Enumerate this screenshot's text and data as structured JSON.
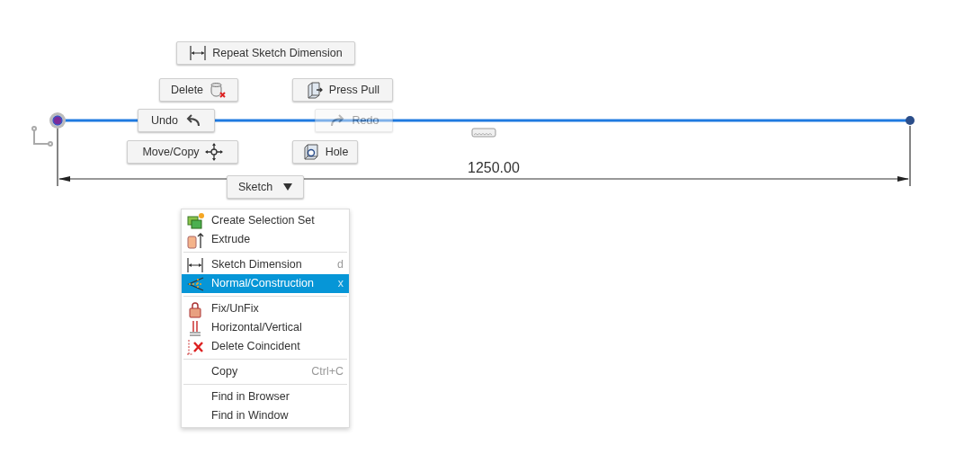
{
  "marking_menu": {
    "buttons": [
      {
        "label": "Repeat Sketch Dimension",
        "disabled": false
      },
      {
        "label": "Delete",
        "disabled": false
      },
      {
        "label": "Press Pull",
        "disabled": false
      },
      {
        "label": "Undo",
        "disabled": false
      },
      {
        "label": "Redo",
        "disabled": true
      },
      {
        "label": "Move/Copy",
        "disabled": false
      },
      {
        "label": "Hole",
        "disabled": false
      }
    ],
    "dropdown": {
      "label": "Sketch"
    }
  },
  "sketch": {
    "dimension": "1250.00"
  },
  "context_menu": {
    "groups": [
      {
        "items": [
          {
            "label": "Create Selection Set",
            "selected": false
          },
          {
            "label": "Extrude",
            "selected": false
          }
        ]
      },
      {
        "items": [
          {
            "label": "Sketch Dimension",
            "shortcut": "d",
            "selected": false
          },
          {
            "label": "Normal/Construction",
            "shortcut": "x",
            "selected": true
          }
        ]
      },
      {
        "items": [
          {
            "label": "Fix/UnFix",
            "selected": false
          },
          {
            "label": "Horizontal/Vertical",
            "selected": false
          },
          {
            "label": "Delete Coincident",
            "selected": false
          }
        ]
      },
      {
        "items": [
          {
            "label": "Copy",
            "shortcut": "Ctrl+C",
            "selected": false
          }
        ]
      },
      {
        "items": [
          {
            "label": "Find in Browser",
            "selected": false
          },
          {
            "label": "Find in Window",
            "selected": false
          }
        ]
      }
    ]
  }
}
